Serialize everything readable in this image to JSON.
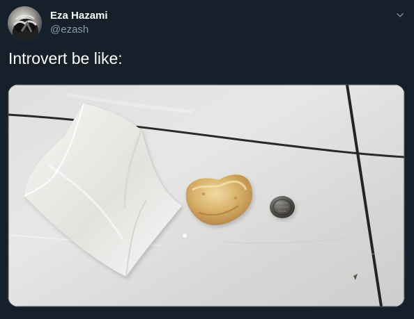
{
  "tweet": {
    "display_name": "Eza Hazami",
    "handle": "@ezash",
    "text": "Introvert be like:"
  },
  "icons": {
    "avatar": "profile-avatar",
    "more": "chevron-down-icon"
  },
  "colors": {
    "background": "#15202b",
    "primary_text": "#ffffff",
    "secondary_text": "#8899a6",
    "border": "#38444d"
  }
}
